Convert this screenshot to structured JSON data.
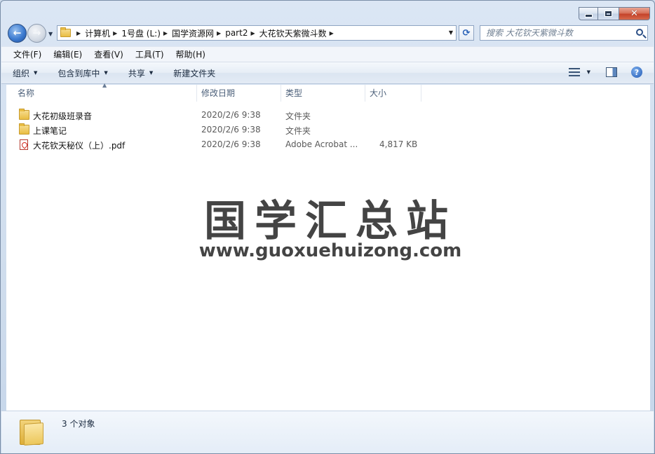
{
  "window": {
    "caption_buttons": [
      "minimize",
      "maximize",
      "close"
    ]
  },
  "address": {
    "breadcrumbs": [
      "计算机",
      "1号盘 (L:)",
      "国学资源网",
      "part2",
      "大花钦天紫微斗数"
    ]
  },
  "search": {
    "placeholder": "搜索 大花钦天紫微斗数"
  },
  "menubar": {
    "items": [
      "文件(F)",
      "编辑(E)",
      "查看(V)",
      "工具(T)",
      "帮助(H)"
    ]
  },
  "commandbar": {
    "organize": "组织",
    "include_in_library": "包含到库中",
    "share": "共享",
    "new_folder": "新建文件夹"
  },
  "columns": {
    "name": "名称",
    "date_modified": "修改日期",
    "type": "类型",
    "size": "大小"
  },
  "files": [
    {
      "icon": "folder-icon",
      "name": "大花初级班录音",
      "date": "2020/2/6 9:38",
      "type": "文件夹",
      "size": ""
    },
    {
      "icon": "folder-icon",
      "name": "上课笔记",
      "date": "2020/2/6 9:38",
      "type": "文件夹",
      "size": ""
    },
    {
      "icon": "pdf-icon",
      "name": "大花钦天秘仪（上）.pdf",
      "date": "2020/2/6 9:38",
      "type": "Adobe Acrobat ...",
      "size": "4,817 KB"
    }
  ],
  "watermark": {
    "title": "国学汇总站",
    "url": "www.guoxuehuizong.com"
  },
  "details": {
    "item_count": "3 个对象"
  },
  "colors": {
    "window_frame": "#cfdded",
    "close_button": "#c5432a",
    "back_button": "#3d7bd0",
    "watermark": "#444444"
  }
}
